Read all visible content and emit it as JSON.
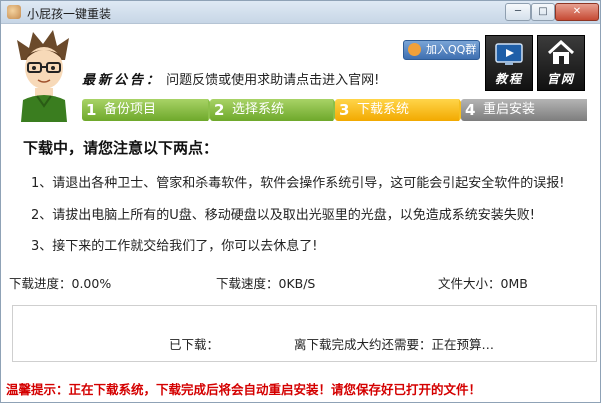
{
  "window": {
    "title": "小屁孩一键重装",
    "controls": {
      "minimize": "─",
      "maximize": "□",
      "close": "✕"
    }
  },
  "header": {
    "notice_title": "最新公告：",
    "notice_text": "问题反馈或使用求助请点击进入官网!",
    "qq_group_label": "加入QQ群",
    "tutorial_label": "教程",
    "official_site_label": "官网"
  },
  "steps": [
    {
      "number": "1",
      "label": "备份项目",
      "state": "done"
    },
    {
      "number": "2",
      "label": "选择系统",
      "state": "done"
    },
    {
      "number": "3",
      "label": "下载系统",
      "state": "active"
    },
    {
      "number": "4",
      "label": "重启安装",
      "state": "pending"
    }
  ],
  "content": {
    "heading": "下载中，请您注意以下两点：",
    "lines": [
      "1、请退出各种卫士、管家和杀毒软件，软件会操作系统引导，这可能会引起安全软件的误报!",
      "2、请拔出电脑上所有的U盘、移动硬盘以及取出光驱里的光盘，以免造成系统安装失败!",
      "3、接下来的工作就交给我们了，你可以去休息了!"
    ],
    "progress_text": "下载进度：0.00%",
    "speed_text": "下载速度：0KB/S",
    "size_text": "文件大小：0MB",
    "downloaded_text": "已下载：",
    "remaining_text": "离下载完成大约还需要：正在预算…",
    "tip": "温馨提示：正在下载系统，下载完成后将会自动重启安装！请您保存好已打开的文件！"
  },
  "colors": {
    "step_done": "#6ea82b",
    "step_active": "#f2a900",
    "step_pending": "#7d7d7d",
    "tip": "#d40000"
  }
}
